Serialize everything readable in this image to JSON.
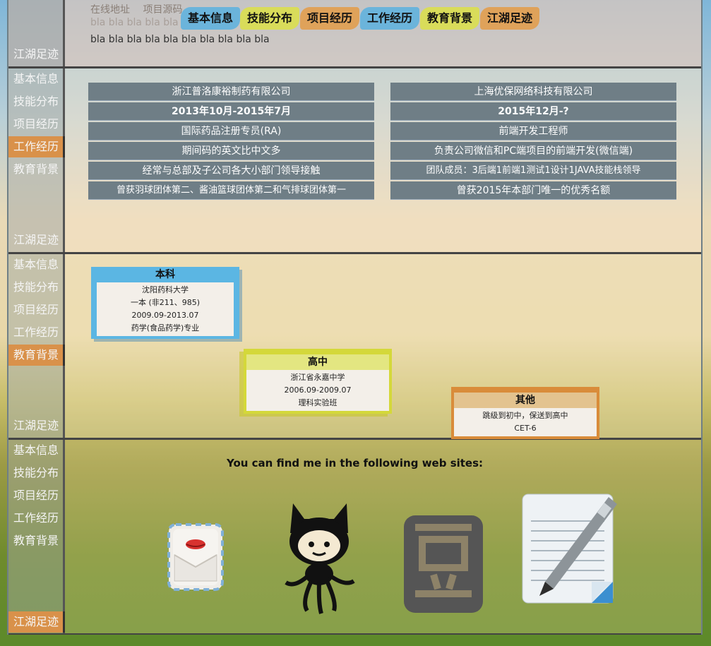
{
  "header": {
    "links": [
      "在线地址",
      "项目源码"
    ],
    "bla_faded": "bla bla bla bla bla",
    "bla": "bla bla bla bla bla bla bla bla bla bla",
    "tabs": [
      {
        "label": "基本信息",
        "color": "#6bb4db"
      },
      {
        "label": "技能分布",
        "color": "#d9dc5a"
      },
      {
        "label": "项目经历",
        "color": "#dfa25a"
      },
      {
        "label": "工作经历",
        "color": "#6bb4db"
      },
      {
        "label": "教育背景",
        "color": "#d9dc5a"
      },
      {
        "label": "江湖足迹",
        "color": "#dfa25a"
      }
    ],
    "footer_nav": "江湖足迹"
  },
  "nav": [
    "基本信息",
    "技能分布",
    "项目经历",
    "工作经历",
    "教育背景",
    "江湖足迹"
  ],
  "work": {
    "left": [
      {
        "text": "浙江普洛康裕制药有限公司",
        "bold": false
      },
      {
        "text": "2013年10月-2015年7月",
        "bold": true
      },
      {
        "text": "国际药品注册专员(RA)",
        "bold": false
      },
      {
        "text": "期间码的英文比中文多",
        "bold": false
      },
      {
        "text": "经常与总部及子公司各大小部门领导接触",
        "bold": false
      },
      {
        "text": "曾获羽球团体第二、酱油篮球团体第二和气排球团体第一",
        "bold": false
      }
    ],
    "right": [
      {
        "text": "上海优保网络科技有限公司",
        "bold": false
      },
      {
        "text": "2015年12月-?",
        "bold": true
      },
      {
        "text": "前端开发工程师",
        "bold": false
      },
      {
        "text": "负责公司微信和PC端项目的前端开发(微信端)",
        "bold": false
      },
      {
        "text": "团队成员：3后端1前端1测试1设计1JAVA技能栈领导",
        "bold": false
      },
      {
        "text": "曾获2015年本部门唯一的优秀名额",
        "bold": false
      }
    ]
  },
  "education": [
    {
      "title": "本科",
      "color": "#5bb6e3",
      "lines": [
        "沈阳药科大学",
        "一本 (非211、985)",
        "2009.09-2013.07",
        "药学(食品药学)专业"
      ]
    },
    {
      "title": "高中",
      "color": "#d4d83a",
      "lines": [
        "浙江省永嘉中学",
        "2006.09-2009.07",
        "理科实验班"
      ]
    },
    {
      "title": "其他",
      "color": "#d98c3a",
      "lines": [
        "跳级到初中，保送到高中",
        "CET-6"
      ]
    }
  ],
  "contact": {
    "title": "You can find me in the following web sites:",
    "icons": [
      "mail-icon",
      "github-octocat-icon",
      "douban-icon",
      "blog-pen-icon"
    ]
  }
}
